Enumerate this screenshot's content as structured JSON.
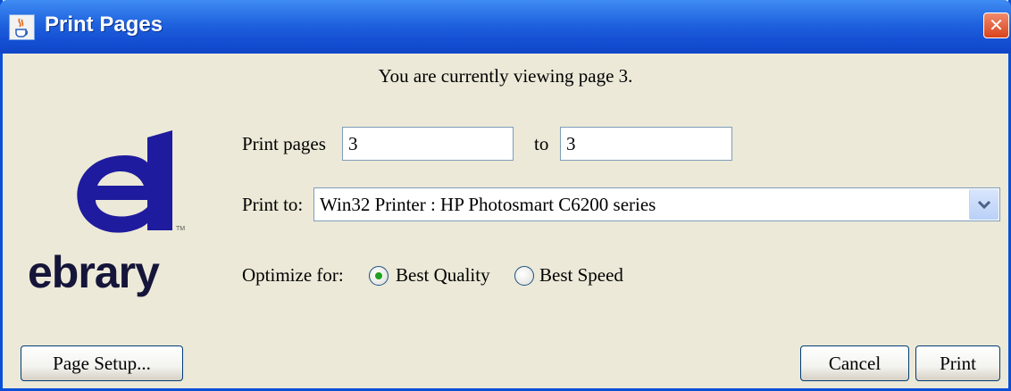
{
  "window": {
    "title": "Print Pages",
    "close_symbol": "✕",
    "app_icon": "java-cup-icon"
  },
  "info": {
    "text": "You are currently viewing page  3."
  },
  "print_pages": {
    "label": "Print pages",
    "from_value": "3",
    "to_label": "to",
    "to_value": "3"
  },
  "print_to": {
    "label": "Print to:",
    "selected": "Win32 Printer : HP Photosmart C6200 series"
  },
  "optimize": {
    "label": "Optimize for:",
    "options": [
      {
        "label": "Best Quality",
        "selected": true
      },
      {
        "label": "Best Speed",
        "selected": false
      }
    ]
  },
  "buttons": {
    "page_setup": "Page Setup...",
    "cancel": "Cancel",
    "print": "Print"
  },
  "logo": {
    "word": "ebrary",
    "tm": "TM",
    "color": "#1f1b9e"
  },
  "colors": {
    "titlebar": "#1f62de",
    "dialog_bg": "#ece9d8",
    "close": "#d9431d",
    "radio_selected": "#21a121"
  }
}
